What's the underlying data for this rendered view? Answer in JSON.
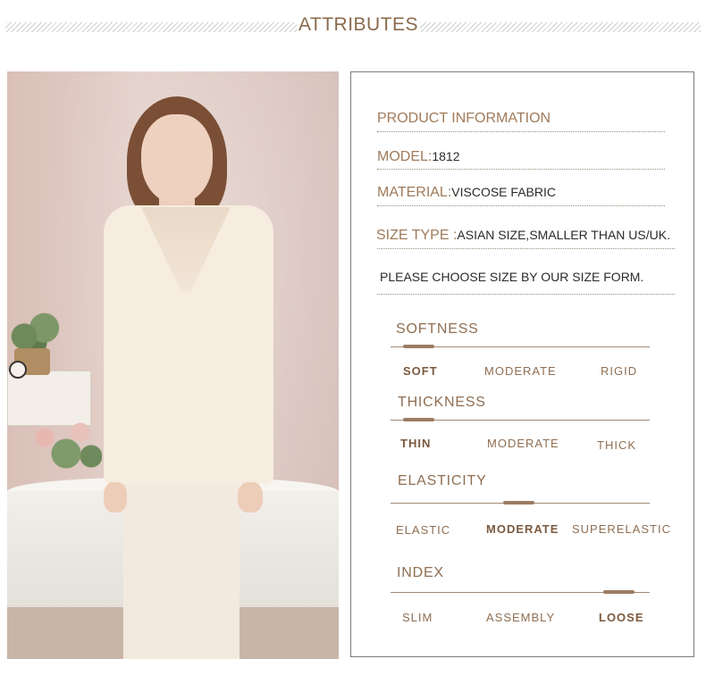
{
  "header": {
    "title": "ATTRIBUTES"
  },
  "photo": {
    "alt": "Model wearing cream pajama set with lace V-neck"
  },
  "info": {
    "heading": "PRODUCT INFORMATION",
    "model_key": "MODEL:",
    "model_value": "1812",
    "material_key": "MATERIAL:",
    "material_value": "VISCOSE FABRIC",
    "size_key": "SIZE TYPE :",
    "size_value": "ASIAN SIZE,SMALLER THAN US/UK.",
    "note": "PLEASE CHOOSE SIZE BY OUR SIZE FORM."
  },
  "attributes": [
    {
      "title": "SOFTNESS",
      "options": [
        "SOFT",
        "MODERATE",
        "RIGID"
      ],
      "selected_index": 0
    },
    {
      "title": "THICKNESS",
      "options": [
        "THIN",
        "MODERATE",
        "THICK"
      ],
      "selected_index": 0
    },
    {
      "title": "ELASTICITY",
      "options": [
        "ELASTIC",
        "MODERATE",
        "SUPERELASTIC"
      ],
      "selected_index": 1
    },
    {
      "title": "INDEX",
      "options": [
        "SLIM",
        "ASSEMBLY",
        "LOOSE"
      ],
      "selected_index": 2
    }
  ],
  "colors": {
    "accent": "#9c7c62",
    "label": "#a07a5a",
    "border": "#7d7d7d"
  }
}
